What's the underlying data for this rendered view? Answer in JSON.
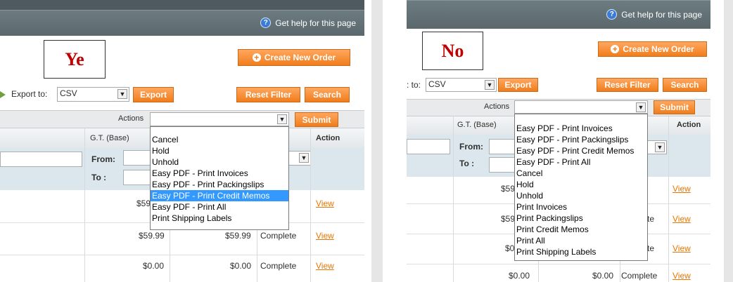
{
  "left": {
    "help_label": "Get help for this page",
    "tag_label": "Ye",
    "create_order_label": "Create New Order",
    "export_label": "Export to:",
    "export_format": "CSV",
    "export_button": "Export",
    "reset_filter": "Reset Filter",
    "search": "Search",
    "actions_label": "Actions",
    "submit": "Submit",
    "col_gt_base": "G.T. (Base)",
    "col_action": "Action",
    "from_label": "From:",
    "to_label": "To :",
    "options": [
      "",
      "Cancel",
      "Hold",
      "Unhold",
      "Easy PDF - Print Invoices",
      "Easy PDF - Print Packingslips",
      "Easy PDF - Print Credit Memos",
      "Easy PDF - Print All",
      "Print Shipping Labels"
    ],
    "highlighted_option": "Easy PDF - Print Credit Memos",
    "rows": [
      {
        "gt_base": "$59",
        "gt_purchased": "",
        "status": "",
        "view": "View"
      },
      {
        "gt_base": "$59.99",
        "gt_purchased": "$59.99",
        "status": "Complete",
        "view": "View"
      },
      {
        "gt_base": "$0.00",
        "gt_purchased": "$0.00",
        "status": "Complete",
        "view": "View"
      }
    ]
  },
  "right": {
    "help_label": "Get help for this page",
    "tag_label": "No",
    "create_order_label": "Create New Order",
    "export_label": ": to:",
    "export_format": "CSV",
    "export_button": "Export",
    "reset_filter": "Reset Filter",
    "search": "Search",
    "actions_label": "Actions",
    "submit": "Submit",
    "col_gt_base": "G.T. (Base)",
    "col_action": "Action",
    "from_label": "From:",
    "to_label": "To :",
    "options": [
      "",
      "Easy PDF - Print Invoices",
      "Easy PDF - Print Packingslips",
      "Easy PDF - Print Credit Memos",
      "Easy PDF - Print All",
      "Cancel",
      "Hold",
      "Unhold",
      "Print Invoices",
      "Print Packingslips",
      "Print Credit Memos",
      "Print All",
      "Print Shipping Labels"
    ],
    "rows": [
      {
        "gt_base": "$59",
        "gt_purchased": "",
        "status": "",
        "view": "View"
      },
      {
        "gt_base": "$59",
        "gt_purchased": "",
        "status": "te",
        "view": "View"
      },
      {
        "gt_base": "$0",
        "gt_purchased": "",
        "status": "te",
        "view": "View"
      },
      {
        "gt_base": "$0.00",
        "gt_purchased": "$0.00",
        "status": "Complete",
        "view": "View"
      }
    ]
  }
}
